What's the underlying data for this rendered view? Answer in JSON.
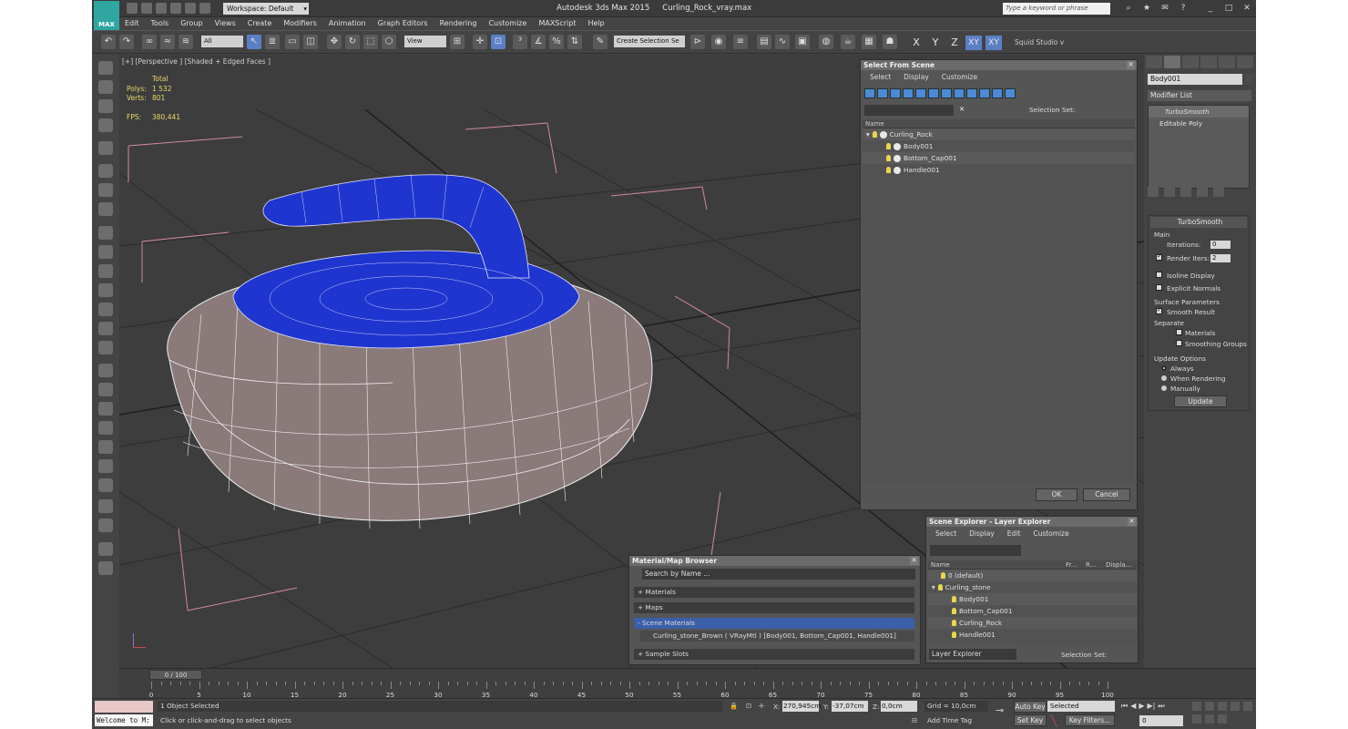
{
  "titlebar": {
    "app_title": "Autodesk 3ds Max  2015",
    "file_name": "Curling_Rock_vray.max",
    "workspace": "Workspace: Default",
    "search_placeholder": "Type a keyword or phrase",
    "logo": "MAX"
  },
  "menu": [
    "Edit",
    "Tools",
    "Group",
    "Views",
    "Create",
    "Modifiers",
    "Animation",
    "Graph Editors",
    "Rendering",
    "Customize",
    "MAXScript",
    "Help"
  ],
  "toolbar": {
    "filter": "All",
    "view": "View",
    "selection_set": "Create Selection Se",
    "axes": [
      "X",
      "Y",
      "Z",
      "XY",
      "XY"
    ],
    "studio": "Squid Studio v"
  },
  "viewport": {
    "label": "[+] [Perspective ] [Shaded + Edged Faces ]",
    "stats": {
      "header": "Total",
      "polys_label": "Polys:",
      "polys": "1 532",
      "verts_label": "Verts:",
      "verts": "801",
      "fps_label": "FPS:",
      "fps": "380,441"
    }
  },
  "select_from_scene": {
    "title": "Select From Scene",
    "menu": [
      "Select",
      "Display",
      "Customize"
    ],
    "selection_set_label": "Selection Set:",
    "col_name": "Name",
    "items": [
      "Curling_Rock",
      "Body001",
      "Bottom_Cap001",
      "Handle001"
    ],
    "ok": "OK",
    "cancel": "Cancel"
  },
  "scene_explorer": {
    "title": "Scene Explorer - Layer Explorer",
    "menu": [
      "Select",
      "Display",
      "Edit",
      "Customize"
    ],
    "cols": [
      "Name",
      "Fr...",
      "R...",
      "Displa..."
    ],
    "items": [
      "0 (default)",
      "Curling_stone",
      "Body001",
      "Bottom_Cap001",
      "Curling_Rock",
      "Handle001"
    ],
    "footer_left": "Layer Explorer",
    "footer_right": "Selection Set:"
  },
  "material_browser": {
    "title": "Material/Map Browser",
    "search": "Search by Name ...",
    "sections": [
      "+ Materials",
      "+ Maps",
      "- Scene Materials",
      "+ Sample Slots"
    ],
    "material": "Curling_stone_Brown  ( VRayMtl )  [Body001, Bottom_Cap001, Handle001]"
  },
  "command_panel": {
    "object_name": "Body001",
    "modifier_list": "Modifier List",
    "stack": [
      "TurboSmooth",
      "Editable Poly"
    ],
    "rollout": "TurboSmooth",
    "main": "Main",
    "iterations_label": "Iterations:",
    "iterations": "0",
    "render_iters_label": "Render Iters:",
    "render_iters": "2",
    "isoline": "Isoline Display",
    "explicit": "Explicit Normals",
    "surface_params": "Surface Parameters",
    "smooth_result": "Smooth Result",
    "separate": "Separate",
    "materials": "Materials",
    "smoothing_groups": "Smoothing Groups",
    "update_options": "Update Options",
    "always": "Always",
    "when_rendering": "When Rendering",
    "manually": "Manually",
    "update": "Update"
  },
  "timeline": {
    "frame": "0 / 100",
    "ticks": [
      "0",
      "5",
      "10",
      "15",
      "20",
      "25",
      "30",
      "35",
      "40",
      "45",
      "50",
      "55",
      "60",
      "65",
      "70",
      "75",
      "80",
      "85",
      "90",
      "95",
      "100"
    ]
  },
  "status": {
    "selected": "1 Object Selected",
    "prompt": "Click or click-and-drag to select objects",
    "welcome": "Welcome to M:",
    "x_label": "X:",
    "x": "270,945cm",
    "y_label": "Y:",
    "y": "-37,07cm",
    "z_label": "Z:",
    "z": "0,0cm",
    "grid": "Grid = 10,0cm",
    "add_time_tag": "Add Time Tag",
    "auto_key": "Auto Key",
    "set_key": "Set Key",
    "selected_dd": "Selected",
    "key_filters": "Key Filters...",
    "frame_field": "0"
  }
}
